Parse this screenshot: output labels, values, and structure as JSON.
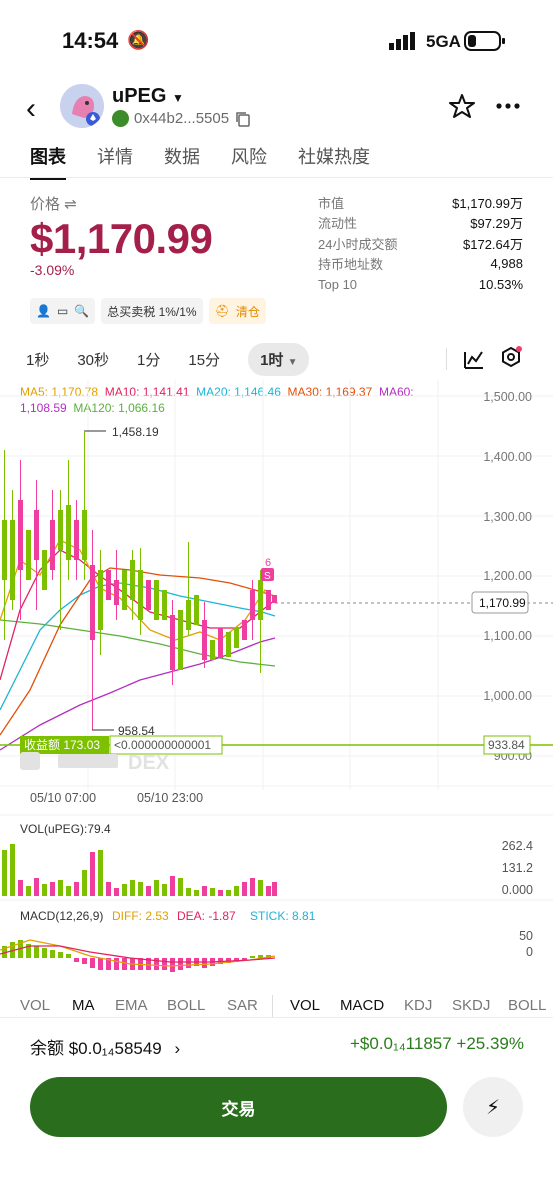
{
  "status_bar": {
    "time": "14:54",
    "network": "5GA"
  },
  "header": {
    "token_name": "uPEG",
    "address": "0x44b2...5505"
  },
  "tabs": [
    "图表",
    "详情",
    "数据",
    "风险",
    "社媒热度"
  ],
  "price": {
    "label": "价格",
    "value": "$1,170.99",
    "change": "-3.09%"
  },
  "stats": [
    {
      "k": "市值",
      "v": "$1,170.99万"
    },
    {
      "k": "流动性",
      "v": "$97.29万"
    },
    {
      "k": "24小时成交额",
      "v": "$172.64万"
    },
    {
      "k": "持币地址数",
      "v": "4,988"
    },
    {
      "k": "Top 10",
      "v": "10.53%"
    }
  ],
  "tags": {
    "tax": "总买卖税 1%/1%",
    "clear": "清仓"
  },
  "intervals": [
    "1秒",
    "30秒",
    "1分",
    "15分",
    "1时"
  ],
  "ma": {
    "ma5": "MA5: 1,170.78",
    "ma10": "MA10: 1,141.41",
    "ma20": "MA20: 1,146.46",
    "ma30": "MA30: 1,169.37",
    "ma60a": "MA60:",
    "ma60b": "1,108.59",
    "ma120": "MA120: 1,066.16"
  },
  "chart_data": {
    "type": "candlestick",
    "y_ticks": [
      "1,500.00",
      "1,400.00",
      "1,300.00",
      "1,200.00",
      "1,100.00",
      "1,000.00",
      "900.00"
    ],
    "ylim": [
      900,
      1500
    ],
    "x_ticks": [
      "05/10 07:00",
      "05/10 23:00"
    ],
    "high_label": "1,458.19",
    "low_label": "958.54",
    "current_price": "1,170.99",
    "profit_label": "收益额 173.03",
    "profit_value": "<0.000000000001",
    "line_label": "933.84",
    "sell_marker": "S",
    "sell_count": "6",
    "watermark": "DEX"
  },
  "volume": {
    "title": "VOL(uPEG):79.4",
    "ticks": [
      "262.4",
      "131.2",
      "0.000"
    ]
  },
  "macd": {
    "title": "MACD(12,26,9)",
    "diff": "DIFF: 2.53",
    "dea": "DEA: -1.87",
    "stick": "STICK: 8.81",
    "ticks": [
      "50",
      "0"
    ]
  },
  "indicators_main": [
    "VOL",
    "MA",
    "EMA",
    "BOLL",
    "SAR"
  ],
  "indicators_sub": [
    "VOL",
    "MACD",
    "KDJ",
    "SKDJ",
    "BOLL"
  ],
  "balance": {
    "label": "余额 $0.0₁₄58549",
    "pnl": "+$0.0₁₄11857 +25.39%"
  },
  "trade_button": "交易",
  "colors": {
    "up": "#7cc000",
    "down": "#ee3fa0",
    "price": "#a4204a",
    "trade": "#2a6d1d"
  }
}
